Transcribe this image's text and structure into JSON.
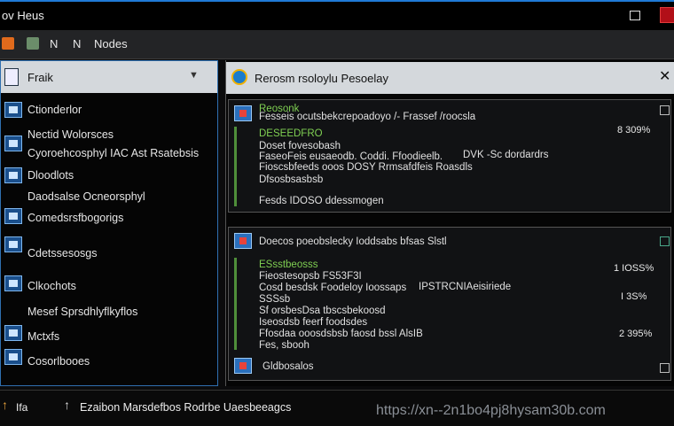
{
  "window": {
    "title": "ov Heus"
  },
  "toolbar": {
    "item1": "N",
    "item2": "N",
    "item3": "Nodes"
  },
  "left_panel": {
    "title": "Fraik",
    "items": [
      "Ctionderlor",
      "Nectid Wolorsces",
      "Cyoroehcosphyl  IAC  Ast Rsatebsis",
      "Dloodlots",
      "Daodsalse Ocneorsphyl",
      "Comedsrsfbogorigs",
      "Cdetssesosgs",
      "Clkochots",
      "Mesef Sprsdhlyflkyflos",
      "Mctxfs",
      "Cosorlbooes"
    ]
  },
  "right_panel": {
    "title": "Rerosm rsoloylu Pesoelay",
    "card1": {
      "lines": [
        "Reosonk",
        "Fesseis ocutsbekcrepoadoyo /- Frassef /roocsla",
        "DESEEDFRO",
        "Doset fovesobash",
        "FaseoFeis eusaeodb. Coddi. Ffoodieelb.",
        "Fioscsbfeeds ooos DOSY Rrmsafdfeis Roasdls",
        "Dfsosbsasbsb",
        "Fesds IDOSO ddessmogen"
      ],
      "side_text": "DVK  -Sc  dordardrs",
      "pct": "8 309%"
    },
    "card2": {
      "header": "Doecos poeobslecky  Ioddsabs bfsas Slstl",
      "lines": [
        "ESsstbeosss",
        "Fieostesopsb  FS53F3I",
        "Cosd besdsk  Foodeloy Ioossaps",
        "SSSsb",
        "Sf orsbesDsa tbscsbekoosd",
        "Iseosdsb feerf foodsdes",
        "Ffosdaa ooosdsbsb  faosd  bssl  AlsIB",
        "Fes, sbooh"
      ],
      "side_text": "IPSTRCNIAeisiriede",
      "pcts": [
        "1 IOSS%",
        "I 3S%",
        "2 395%"
      ]
    },
    "card3": {
      "label": "Gldbosalos"
    }
  },
  "bottom_bar": {
    "left_label": "Ifa",
    "status": "Ezaibon Marsdefbos Rodrbe Uaesbeeagcs",
    "url": "https://xn--2n1bo4pj8hysam30b.com"
  },
  "colors": {
    "accent": "#1f7ad6",
    "highlight_green": "#7fcf52",
    "close_red": "#b10f18"
  }
}
